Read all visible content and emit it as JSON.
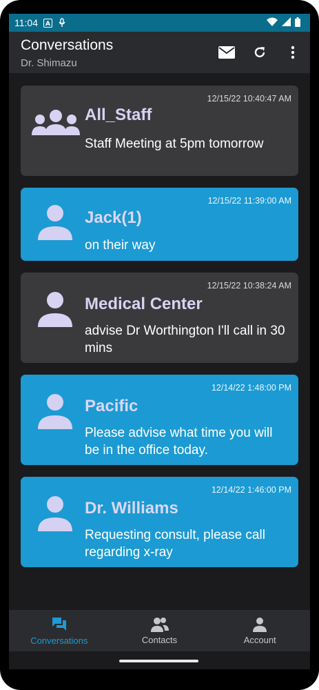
{
  "status": {
    "time": "11:04"
  },
  "header": {
    "title": "Conversations",
    "subtitle": "Dr. Shimazu"
  },
  "conversations": [
    {
      "name": "All_Staff",
      "timestamp": "12/15/22 10:40:47 AM",
      "message": "Staff Meeting at 5pm tomorrow",
      "style": "dark",
      "avatar": "group-icon"
    },
    {
      "name": "Jack(1)",
      "timestamp": "12/15/22 11:39:00 AM",
      "message": "on their way",
      "style": "blue",
      "avatar": "person-icon"
    },
    {
      "name": "Medical Center",
      "timestamp": "12/15/22 10:38:24 AM",
      "message": "advise Dr  Worthington I'll call in 30 mins",
      "style": "dark",
      "avatar": "person-icon"
    },
    {
      "name": "Pacific",
      "timestamp": "12/14/22 1:48:00 PM",
      "message": "Please advise what time you will be in the office today.",
      "style": "blue",
      "avatar": "person-icon"
    },
    {
      "name": "Dr. Williams",
      "timestamp": "12/14/22 1:46:00 PM",
      "message": "Requesting consult, please call regarding x-ray",
      "style": "blue",
      "avatar": "person-icon"
    }
  ],
  "nav": {
    "items": [
      {
        "label": "Conversations",
        "icon": "chat-icon",
        "active": true
      },
      {
        "label": "Contacts",
        "icon": "contacts-icon",
        "active": false
      },
      {
        "label": "Account",
        "icon": "account-icon",
        "active": false
      }
    ]
  },
  "colors": {
    "accent": "#1e9ad6",
    "card_blue": "#1c9ad3",
    "card_dark": "#3a3a3d",
    "statusbar": "#0b6d8c"
  }
}
